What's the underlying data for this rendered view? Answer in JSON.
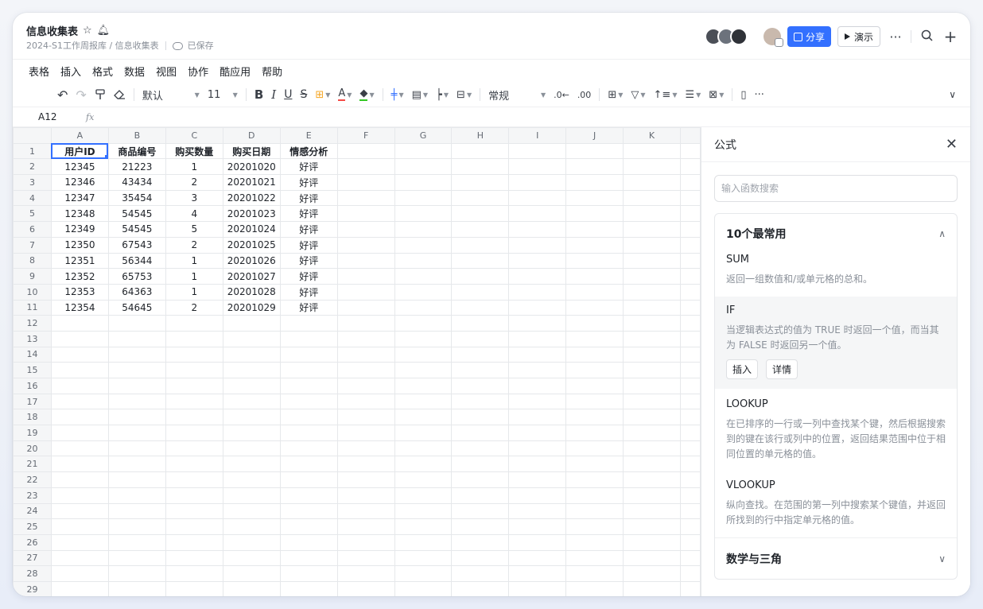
{
  "doc": {
    "title": "信息收集表",
    "breadcrumb": "2024-S1工作周报库 / 信息收集表",
    "saved": "已保存"
  },
  "header": {
    "share_label": "分享",
    "present_label": "演示"
  },
  "menu": [
    "表格",
    "插入",
    "格式",
    "数据",
    "视图",
    "协作",
    "酷应用",
    "帮助"
  ],
  "toolbar": {
    "font": "默认",
    "size": "11",
    "bold": "B",
    "italic": "I",
    "underline": "U",
    "strike": "S",
    "font_color_letter": "A",
    "format": "常规"
  },
  "formula_bar": {
    "cell_ref": "A12",
    "fx": "fx"
  },
  "grid": {
    "columns": [
      "A",
      "B",
      "C",
      "D",
      "E",
      "F",
      "G",
      "H",
      "I",
      "J",
      "K"
    ],
    "header_row": [
      "用户ID",
      "商品编号",
      "购买数量",
      "购买日期",
      "情感分析"
    ],
    "rows": [
      [
        "12345",
        "21223",
        "1",
        "20201020",
        "好评"
      ],
      [
        "12346",
        "43434",
        "2",
        "20201021",
        "好评"
      ],
      [
        "12347",
        "35454",
        "3",
        "20201022",
        "好评"
      ],
      [
        "12348",
        "54545",
        "4",
        "20201023",
        "好评"
      ],
      [
        "12349",
        "54545",
        "5",
        "20201024",
        "好评"
      ],
      [
        "12350",
        "67543",
        "2",
        "20201025",
        "好评"
      ],
      [
        "12351",
        "56344",
        "1",
        "20201026",
        "好评"
      ],
      [
        "12352",
        "65753",
        "1",
        "20201027",
        "好评"
      ],
      [
        "12353",
        "64363",
        "1",
        "20201028",
        "好评"
      ],
      [
        "12354",
        "54645",
        "2",
        "20201029",
        "好评"
      ]
    ],
    "total_rows": 30
  },
  "panel": {
    "title": "公式",
    "search_placeholder": "输入函数搜索",
    "group_title": "10个最常用",
    "functions": [
      {
        "name": "SUM",
        "desc": "返回一组数值和/或单元格的总和。"
      },
      {
        "name": "IF",
        "desc": "当逻辑表达式的值为 TRUE 时返回一个值，而当其为 FALSE 时返回另一个值。",
        "insert": "插入",
        "detail": "详情"
      },
      {
        "name": "LOOKUP",
        "desc": "在已排序的一行或一列中查找某个键，然后根据搜索到的键在该行或列中的位置，返回结果范围中位于相同位置的单元格的值。"
      },
      {
        "name": "VLOOKUP",
        "desc": "纵向查找。在范围的第一列中搜索某个键值，并返回所找到的行中指定单元格的值。"
      }
    ],
    "group2_title": "数学与三角"
  }
}
